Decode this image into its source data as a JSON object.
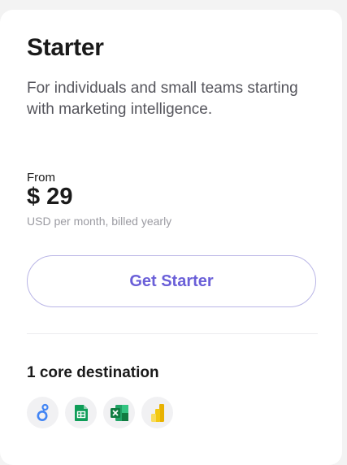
{
  "plan": {
    "title": "Starter",
    "description": "For individuals and small teams starting with marketing intelligence."
  },
  "pricing": {
    "from_label": "From",
    "price": "$ 29",
    "note": "USD per month, billed yearly"
  },
  "cta": {
    "label": "Get Starter"
  },
  "destinations": {
    "title": "1 core destination",
    "icons": [
      "looker-studio-icon",
      "google-sheets-icon",
      "excel-icon",
      "power-bi-icon"
    ]
  },
  "colors": {
    "accent": "#6a5fd8",
    "button_border": "#b9b5e6",
    "muted_text": "#9b9ba2"
  }
}
